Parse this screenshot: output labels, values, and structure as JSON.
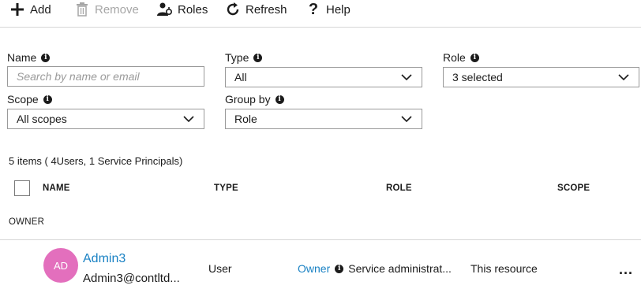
{
  "toolbar": {
    "add_label": "Add",
    "remove_label": "Remove",
    "roles_label": "Roles",
    "refresh_label": "Refresh",
    "help_label": "Help"
  },
  "filters": {
    "name_label": "Name",
    "name_placeholder": "Search by name or email",
    "name_value": "",
    "type_label": "Type",
    "type_value": "All",
    "role_label": "Role",
    "role_value": "3 selected",
    "scope_label": "Scope",
    "scope_value": "All scopes",
    "groupby_label": "Group by",
    "groupby_value": "Role"
  },
  "summary": "5 items ( 4Users, 1 Service Principals)",
  "table": {
    "headers": [
      "NAME",
      "TYPE",
      "ROLE",
      "SCOPE"
    ],
    "group": "OWNER",
    "rows": [
      {
        "initials": "AD",
        "avatar_color": "#e36fbd",
        "name": "Admin3",
        "email": "Admin3@contltd...",
        "type": "User",
        "role": "Owner",
        "role_detail": "Service administrat...",
        "scope": "This resource",
        "more": "..."
      }
    ]
  },
  "icons": {
    "add": "plus-icon",
    "remove": "trash-icon",
    "roles": "roles-icon",
    "refresh": "refresh-icon",
    "help": "question-icon",
    "info": "info-icon",
    "chevron": "chevron-down-icon"
  }
}
